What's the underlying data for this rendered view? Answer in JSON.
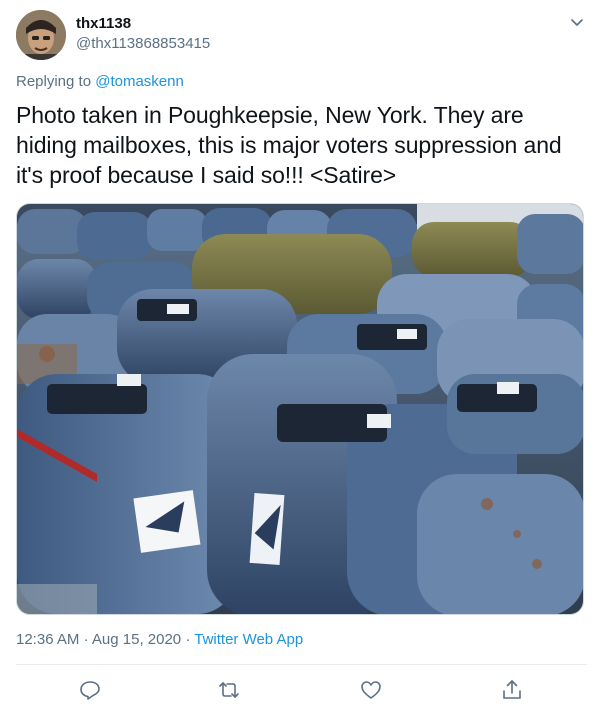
{
  "user": {
    "display_name": "thx1138",
    "handle": "@thx113868853415",
    "avatar_icon": "avatar-photo"
  },
  "reply": {
    "prefix": "Replying to",
    "mention": "@tomaskenn"
  },
  "tweet": {
    "text": "Photo taken in Poughkeepsie, New York. They are hiding mailboxes, this is major voters suppression and it's proof because I said so!!! <Satire>"
  },
  "media": {
    "icon": "photo-of-stacked-blue-mailboxes"
  },
  "meta": {
    "time": "12:36 AM",
    "separator": "·",
    "date": "Aug 15, 2020",
    "source": "Twitter Web App"
  },
  "actions": {
    "icons": [
      "reply-icon",
      "retweet-icon",
      "like-icon",
      "share-icon"
    ]
  },
  "colors": {
    "link": "#1b95e0",
    "secondary_text": "#5b7083",
    "primary_text": "#0f1419",
    "divider": "#e6ecf0"
  }
}
